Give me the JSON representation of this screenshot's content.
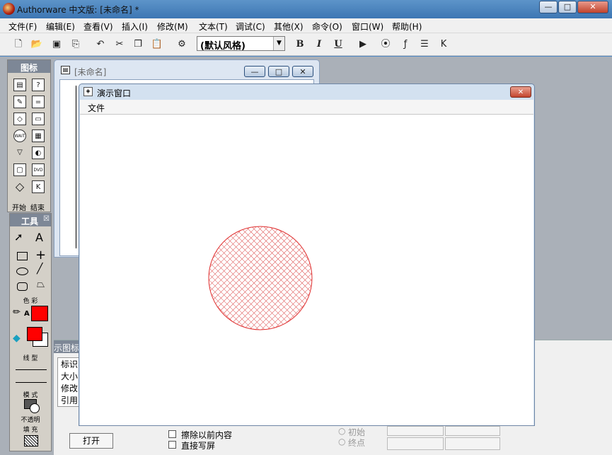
{
  "window": {
    "title": "Authorware 中文版: [未命名] *",
    "minimize": "—",
    "maximize": "□",
    "close": "✕"
  },
  "menu": [
    "文件(F)",
    "编辑(E)",
    "查看(V)",
    "插入(I)",
    "修改(M)",
    "文本(T)",
    "调试(C)",
    "其他(X)",
    "命令(O)",
    "窗口(W)",
    "帮助(H)"
  ],
  "toolbar": {
    "style_value": "(默认风格)",
    "bold": "B",
    "italic": "I",
    "underline": "U"
  },
  "icon_palette": {
    "title": "图标",
    "start_end": [
      "开始",
      "结束"
    ]
  },
  "icon_labels": [
    "WAIT",
    "DVD"
  ],
  "tools_palette": {
    "title": "工具",
    "text_tool": "A",
    "color_label": "色 彩",
    "color_text": "A",
    "line_label": "线 型",
    "mode_label": "模 式",
    "mode_value": "不透明",
    "fill_label": "填 充"
  },
  "flow_window": {
    "title": "[未命名]"
  },
  "presentation": {
    "title": "演示窗口",
    "menu_file": "文件"
  },
  "props_panel": {
    "header": "示图标",
    "labels": [
      "标识",
      "大小",
      "修改",
      "引用"
    ],
    "open_button": "打开",
    "checkbox1": "擦除以前内容",
    "checkbox2": "直接写屏",
    "radio1": "初始",
    "radio2": "终点"
  },
  "colors": {
    "stroke": "#ff0000",
    "fill": "#ff0000",
    "circle": "#e03030"
  }
}
